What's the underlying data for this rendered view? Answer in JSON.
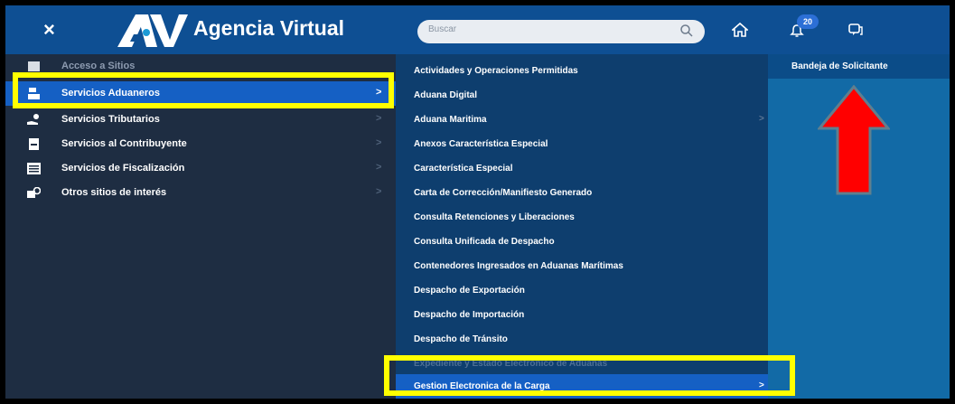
{
  "header": {
    "close_label": "×",
    "brand": "Agencia Virtual",
    "search_placeholder": "Buscar",
    "notification_count": "20",
    "icons": [
      "close-icon",
      "logo",
      "search-icon",
      "home-icon",
      "bell-icon",
      "chat-icon"
    ]
  },
  "sidebar": {
    "items": [
      {
        "label": "Acceso a Sitios",
        "icon": "grid-icon",
        "state": "partially-hidden"
      },
      {
        "label": "Servicios Aduaneros",
        "icon": "customs-icon",
        "state": "active"
      },
      {
        "label": "Servicios Tributarios",
        "icon": "hand-coin-icon"
      },
      {
        "label": "Servicios al Contribuyente",
        "icon": "document-icon"
      },
      {
        "label": "Servicios de Fiscalización",
        "icon": "list-icon"
      },
      {
        "label": "Otros sitios de interés",
        "icon": "link-icon"
      }
    ],
    "chevron": ">"
  },
  "submenu": {
    "items": [
      {
        "label": "Actividades y Operaciones Permitidas"
      },
      {
        "label": "Aduana Digital"
      },
      {
        "label": "Aduana Maritima",
        "has_children": true
      },
      {
        "label": "Anexos Característica Especial"
      },
      {
        "label": "Característica Especial"
      },
      {
        "label": "Carta de Corrección/Manifiesto Generado"
      },
      {
        "label": "Consulta Retenciones y Liberaciones"
      },
      {
        "label": "Consulta Unificada de Despacho"
      },
      {
        "label": "Contenedores Ingresados en Aduanas Marítimas"
      },
      {
        "label": "Despacho de Exportación"
      },
      {
        "label": "Despacho de Importación"
      },
      {
        "label": "Despacho de Tránsito"
      },
      {
        "label": "Expediente y Estado Electrónico de Aduanas",
        "state": "partially-hidden"
      },
      {
        "label": "Gestion Electronica de la Carga",
        "has_children": true,
        "state": "active"
      }
    ],
    "chevron": ">"
  },
  "third_menu": {
    "items": [
      {
        "label": "Bandeja de Solicitante"
      }
    ]
  },
  "annotations": {
    "highlight_color": "#ffff00",
    "arrow_color": "#ff0000",
    "arrow_direction": "up"
  },
  "colors": {
    "header_bg": "#0e4f93",
    "left_panel_bg": "#1e2d42",
    "mid_panel_bg": "#0e3e6e",
    "right_panel_bg": "#126aa6",
    "active_bg": "#1560c4"
  }
}
